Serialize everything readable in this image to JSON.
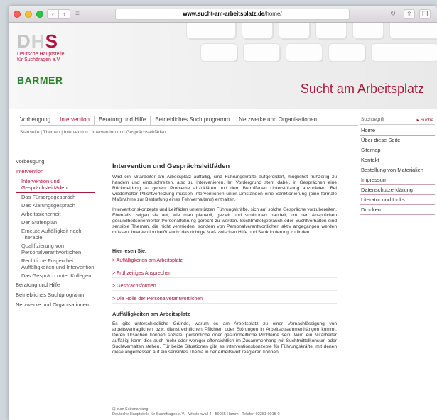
{
  "browser": {
    "url_prefix": "www.sucht-am-arbeitsplatz.de",
    "url_path": "/home/",
    "back_icon": "chevron-left-icon",
    "forward_icon": "chevron-right-icon",
    "sidebar_icon": "sidebar-icon",
    "reload_icon": "reload-icon",
    "share_icon": "share-icon",
    "tabs_icon": "tabs-icon"
  },
  "header": {
    "logo_letters": [
      "D",
      "H",
      "S"
    ],
    "logo_subtitle_1": "Deutsche Hauptstelle",
    "logo_subtitle_2": "für Suchtfragen e.V.",
    "partner": "BARMER",
    "site_title": "Sucht am Arbeitsplatz",
    "accent_color": "#a8183a"
  },
  "main_nav": [
    {
      "label": "Vorbeugung",
      "active": false
    },
    {
      "label": "Intervention",
      "active": true
    },
    {
      "label": "Beratung und Hilfe",
      "active": false
    },
    {
      "label": "Betriebliches Suchtprogramm",
      "active": false
    },
    {
      "label": "Netzwerke und Organisationen",
      "active": false
    }
  ],
  "breadcrumb": "Startseite | Themen | Intervention | Intervention und Gesprächsleitfäden",
  "left_nav": {
    "vorbeugung": "Vorbeugung",
    "intervention": "Intervention",
    "sub": [
      "Intervention und Gesprächsleitfäden",
      "Das Fürsorgegespräch",
      "Das Klärungsgespräch",
      "Arbeitssicherheit",
      "Der Stufenplan",
      "Erneute Auffälligkeit nach Therapie",
      "Qualifizierung von Personalverantwortlichen",
      "Rechtliche Fragen bei Auffälligkeiten und Intervention",
      "Das Gespräch unter Kollegen"
    ],
    "beratung": "Beratung und Hilfe",
    "betriebliches": "Betriebliches Suchtprogramm",
    "netzwerke": "Netzwerke und Organisationen"
  },
  "content": {
    "title": "Intervention und Gesprächsleitfäden",
    "p1": "Wird ein Mitarbeiter am Arbeitsplatz auffällig, sind Führungskräfte aufgefordert, möglichst frühzeitig zu handeln und einzuschreiten, also zu intervenieren. Im Vordergrund steht dabei, in Gesprächen eine Rückmeldung zu geben, Probleme abzuklären und dem Betroffenen Unterstützung anzubieten. Bei wiederholter Pflichtverletzung müssen Interventionen unter Umständen eine Sanktionierung (eine formale Maßnahme zur Bestrafung eines Fehlverhaltens) enthalten.",
    "p2": "Interventionskonzepte und Leitfäden unterstützen Führungskräfte, sich auf solche Gespräche vorzubereiten. Ebenfalls zeigen sie auf, wie man planvoll, gezielt und strukturiert handelt, um den Ansprüchen gesundheitsorientierter Personalführung gerecht zu werden. Suchtmittelgebrauch oder Suchtverhalten sind sensible Themen, die nicht vermieden, sondern von Personalverantwortlichen aktiv angegangen werden müssen. Intervention heißt auch: das richtige Maß zwischen Hilfe und Sanktionierung zu finden.",
    "read_heading": "Hier lesen Sie:",
    "links": [
      "> Auffälligkeiten am Arbeitsplatz",
      "> Frühzeitiges Ansprechen",
      "> Gesprächsformen",
      "> Die Rolle der Personalverantwortlichen"
    ],
    "section_title": "Auffälligkeiten am Arbeitsplatz",
    "section_text": "Es gibt unterschiedliche Gründe, warum es am Arbeitsplatz zu einer Vernachlässigung von arbeitsvertraglichen bzw. dienstrechtlichen Pflichten oder Störungen in Arbeitszusammenhängen kommt. Deren Ursachen können soziale, persönliche oder gesundheitliche Probleme sein. Wird ein Mitarbeiter auffällig, kann dies auch mehr oder weniger offensichtlich im Zusammenhang mit Suchtmittelkonsum oder Suchtverhalten stehen. Für beide Situationen gibt es Interventionskonzepte für Führungskräfte, mit denen diese angemessen auf ein sensibles Thema in der Arbeitswelt reagieren können."
  },
  "footer": {
    "top_link": "zum Seitenanfang",
    "address": "Deutsche Hauptstelle für Suchtfragen e.V. · Westenwall 4 · 59065 Hamm · Telefon 02381 9015-0"
  },
  "right": {
    "search_label": "Suchbegriff",
    "search_button": "▸ Suche",
    "links": [
      "Home",
      "Über diese Seite",
      "Sitemap",
      "Kontakt",
      "Bestellung von Materialien",
      "Impressum",
      "Datenschutzerklärung",
      "Literatur und Links",
      "Drucken"
    ]
  }
}
